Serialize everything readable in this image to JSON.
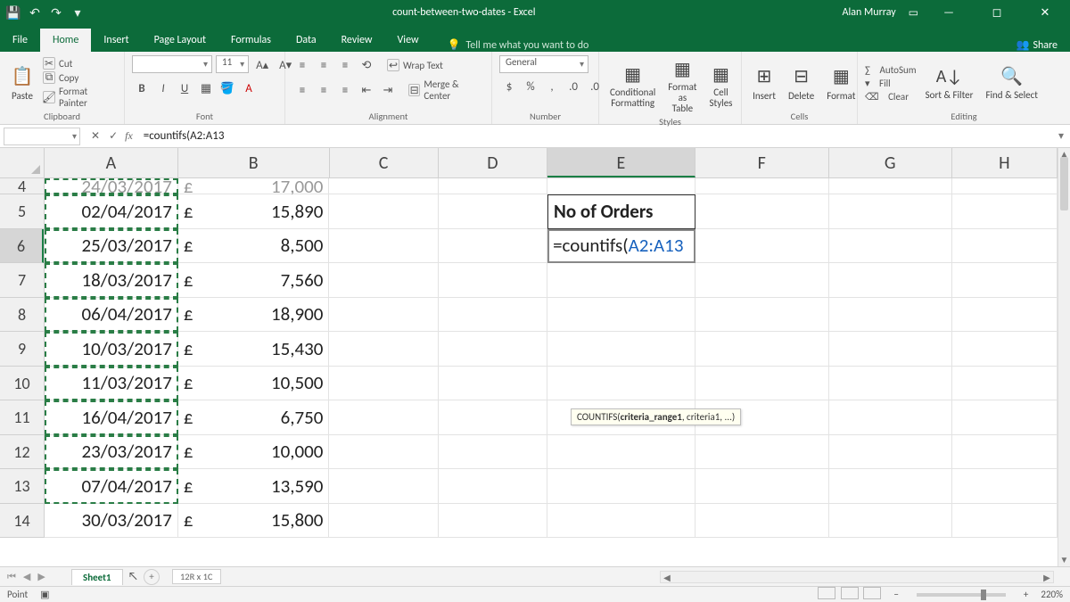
{
  "titlebar": {
    "doc_title": "count-between-two-dates - Excel",
    "user": "Alan Murray"
  },
  "tabs": {
    "file": "File",
    "items": [
      "Home",
      "Insert",
      "Page Layout",
      "Formulas",
      "Data",
      "Review",
      "View"
    ],
    "active": "Home",
    "tellme": "Tell me what you want to do",
    "share": "Share"
  },
  "ribbon": {
    "clipboard": {
      "paste": "Paste",
      "cut": "Cut",
      "copy": "Copy",
      "painter": "Format Painter",
      "label": "Clipboard"
    },
    "font": {
      "size": "11",
      "label": "Font"
    },
    "alignment": {
      "wrap": "Wrap Text",
      "merge": "Merge & Center",
      "label": "Alignment"
    },
    "number": {
      "format": "General",
      "label": "Number"
    },
    "styles": {
      "cond": "Conditional Formatting",
      "table": "Format as Table",
      "cell": "Cell Styles",
      "label": "Styles"
    },
    "cells": {
      "insert": "Insert",
      "delete": "Delete",
      "format": "Format",
      "label": "Cells"
    },
    "editing": {
      "autosum": "AutoSum",
      "fill": "Fill",
      "clear": "Clear",
      "sort": "Sort & Filter",
      "find": "Find & Select",
      "label": "Editing"
    }
  },
  "formula_bar": {
    "name_box": "",
    "formula": "=countifs(A2:A13"
  },
  "columns": [
    "A",
    "B",
    "C",
    "D",
    "E",
    "F",
    "G",
    "H"
  ],
  "rows_visible": [
    4,
    5,
    6,
    7,
    8,
    9,
    10,
    11,
    12,
    13,
    14
  ],
  "rowdata": {
    "4": {
      "A": "24/03/2017",
      "B_sym": "£",
      "B": "17,000"
    },
    "5": {
      "A": "02/04/2017",
      "B_sym": "£",
      "B": "15,890"
    },
    "6": {
      "A": "25/03/2017",
      "B_sym": "£",
      "B": "8,500"
    },
    "7": {
      "A": "18/03/2017",
      "B_sym": "£",
      "B": "7,560"
    },
    "8": {
      "A": "06/04/2017",
      "B_sym": "£",
      "B": "18,900"
    },
    "9": {
      "A": "10/03/2017",
      "B_sym": "£",
      "B": "15,430"
    },
    "10": {
      "A": "11/03/2017",
      "B_sym": "£",
      "B": "10,500"
    },
    "11": {
      "A": "16/04/2017",
      "B_sym": "£",
      "B": "6,750"
    },
    "12": {
      "A": "23/03/2017",
      "B_sym": "£",
      "B": "10,000"
    },
    "13": {
      "A": "07/04/2017",
      "B_sym": "£",
      "B": "13,590"
    },
    "14": {
      "A": "30/03/2017",
      "B_sym": "£",
      "B": "15,800"
    }
  },
  "e5_header": "No of Orders",
  "e6_edit_plain": "=countifs(",
  "e6_edit_range": "A2:A13",
  "tooltip": {
    "fn": "COUNTIFS(",
    "arg_bold": "criteria_range1",
    "rest": ", criteria1, ...)"
  },
  "sheetbar": {
    "sheet": "Sheet1",
    "range_indicator": "12R x 1C"
  },
  "statusbar": {
    "mode": "Point",
    "zoom": "220%"
  }
}
